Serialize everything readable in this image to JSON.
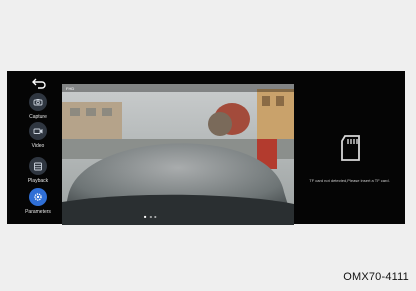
{
  "nav": {
    "back_icon": "return-arrow-icon",
    "items": [
      {
        "label": "Capture",
        "icon": "photo-camera-icon",
        "active": false
      },
      {
        "label": "Video",
        "icon": "video-camera-icon",
        "active": false
      },
      {
        "label": "Playback",
        "icon": "playback-icon",
        "active": false
      },
      {
        "label": "Parameters",
        "icon": "gear-icon",
        "active": true
      }
    ]
  },
  "camera": {
    "top_left": "FHD",
    "top_mid": "",
    "bottom_status": "■ ◂ ▸"
  },
  "tf": {
    "icon": "sd-card-icon",
    "message": "TF card not detected,Please insert a TF card."
  },
  "model_code": "OMX70-4111",
  "colors": {
    "accent": "#2f6fd6",
    "screen_bg": "#050505",
    "page_bg": "#efefef"
  }
}
